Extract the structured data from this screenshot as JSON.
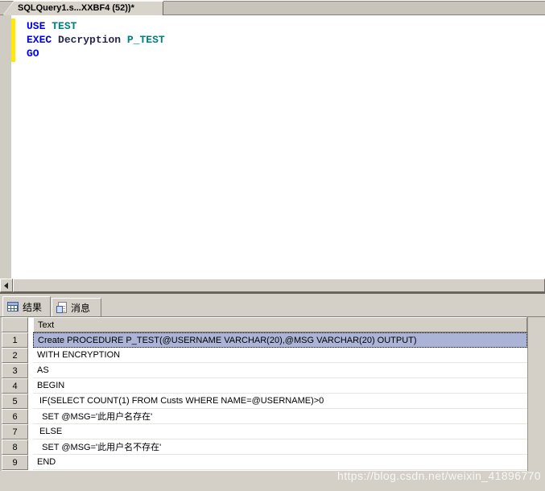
{
  "window": {
    "doc_tab_title": "SQLQuery1.s...XXBF4 (52))*"
  },
  "colors": {
    "keyword": "#0000ee",
    "identifier_teal": "#008080",
    "proc_name": "#26264f",
    "plain": "#000000",
    "selection_bg": "#abb4d6",
    "changed_lines_bar": "#ffe900"
  },
  "editor": {
    "lines": [
      {
        "tokens": [
          {
            "t": "USE",
            "c": "keyword"
          },
          {
            "t": " ",
            "c": "plain"
          },
          {
            "t": "TEST",
            "c": "identifier_teal"
          }
        ]
      },
      {
        "tokens": [
          {
            "t": "EXEC",
            "c": "keyword"
          },
          {
            "t": " ",
            "c": "plain"
          },
          {
            "t": "Decryption",
            "c": "proc_name"
          },
          {
            "t": " ",
            "c": "plain"
          },
          {
            "t": "P_TEST",
            "c": "identifier_teal"
          }
        ]
      },
      {
        "tokens": [
          {
            "t": "GO",
            "c": "keyword"
          }
        ]
      }
    ]
  },
  "results_pane": {
    "tabs": [
      {
        "label": "结果",
        "icon": "results-grid-icon",
        "selected": true
      },
      {
        "label": "消息",
        "icon": "messages-icon",
        "selected": false
      }
    ],
    "grid": {
      "header": {
        "corner": "",
        "text_column": "Text"
      },
      "rows": [
        {
          "num": "1",
          "text": "Create PROCEDURE P_TEST(@USERNAME VARCHAR(20),@MSG VARCHAR(20) OUTPUT)",
          "selected": true
        },
        {
          "num": "2",
          "text": "WITH ENCRYPTION",
          "selected": false
        },
        {
          "num": "3",
          "text": "AS",
          "selected": false
        },
        {
          "num": "4",
          "text": "BEGIN",
          "selected": false
        },
        {
          "num": "5",
          "text": " IF(SELECT COUNT(1) FROM Custs WHERE NAME=@USERNAME)>0",
          "selected": false
        },
        {
          "num": "6",
          "text": "  SET @MSG='此用户名存在'",
          "selected": false
        },
        {
          "num": "7",
          "text": " ELSE",
          "selected": false
        },
        {
          "num": "8",
          "text": "  SET @MSG='此用户名不存在'",
          "selected": false
        },
        {
          "num": "9",
          "text": "END",
          "selected": false
        }
      ]
    }
  },
  "watermark": "https://blog.csdn.net/weixin_41896770"
}
